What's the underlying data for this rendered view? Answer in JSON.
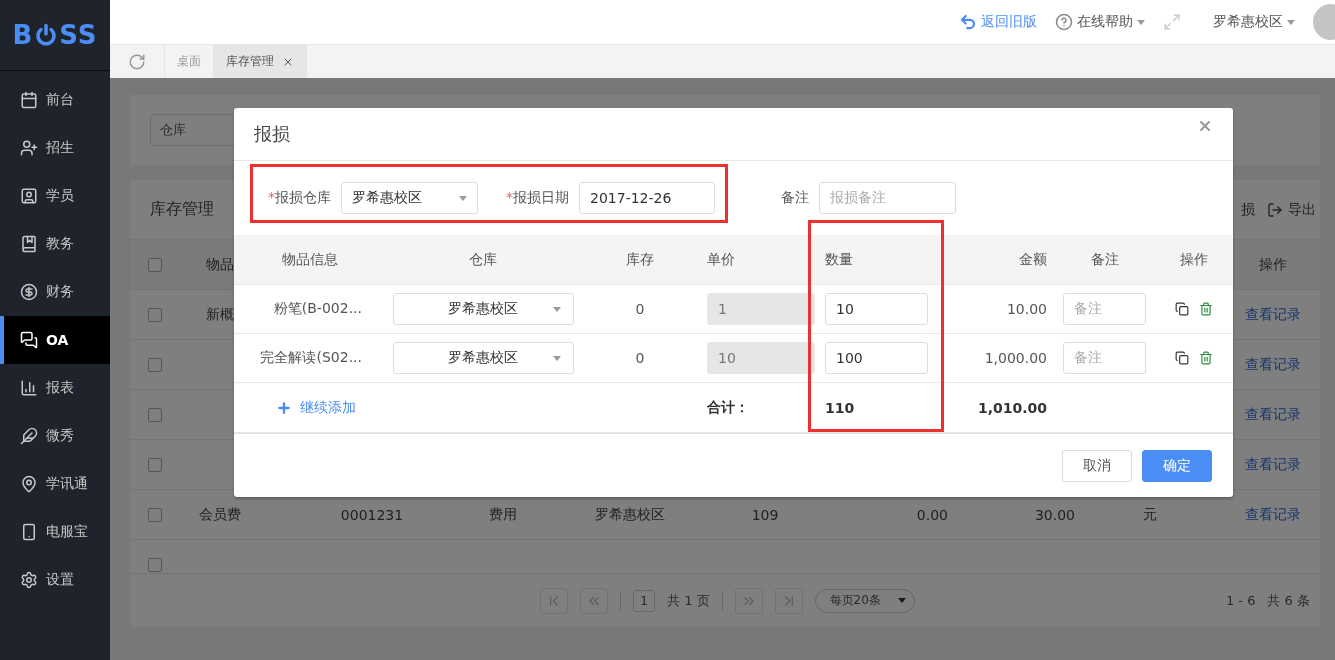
{
  "logo": {
    "before": "B",
    "after": "SS"
  },
  "sidebar": {
    "items": [
      {
        "label": "前台",
        "selected": false
      },
      {
        "label": "招生",
        "selected": false
      },
      {
        "label": "学员",
        "selected": false
      },
      {
        "label": "教务",
        "selected": false
      },
      {
        "label": "财务",
        "selected": false
      },
      {
        "label": "OA",
        "selected": true
      },
      {
        "label": "报表",
        "selected": false
      },
      {
        "label": "微秀",
        "selected": false
      },
      {
        "label": "学讯通",
        "selected": false
      },
      {
        "label": "电服宝",
        "selected": false
      },
      {
        "label": "设置",
        "selected": false
      }
    ]
  },
  "header": {
    "back_link": "返回旧版",
    "help": "在线帮助",
    "campus": "罗希惠校区"
  },
  "tabs": [
    {
      "label": "桌面",
      "selected": false,
      "closable": false
    },
    {
      "label": "库存管理",
      "selected": true,
      "closable": true
    }
  ],
  "filter": {
    "warehouse": "仓库"
  },
  "panel": {
    "title": "库存管理",
    "actions": [
      {
        "label": "损",
        "kind": "plain"
      },
      {
        "label": "导出",
        "kind": "export"
      }
    ]
  },
  "table": {
    "select_all_checked": false,
    "columns": {
      "first": "物品",
      "last": "操作"
    },
    "rows": [
      {
        "checked": false,
        "name": "新概",
        "link": "查看记录"
      },
      {
        "checked": false,
        "link": "查看记录"
      },
      {
        "checked": false,
        "link": "查看记录"
      },
      {
        "checked": false,
        "link": "查看记录"
      },
      {
        "checked": false,
        "name": "会员费",
        "code": "0001231",
        "type": "费用",
        "warehouse": "罗希惠校区",
        "stock": "109",
        "price": "0.00",
        "amount": "30.00",
        "unit": "元",
        "link": "查看记录"
      },
      {
        "checked": false
      }
    ]
  },
  "pagination": {
    "page": "1",
    "total_pages": "共 1 页",
    "page_size": "每页20条",
    "range": "1 - 6",
    "total": "共 6 条"
  },
  "dialog": {
    "title": "报损",
    "form": {
      "warehouse_label": "报损仓库",
      "warehouse": "罗希惠校区",
      "date_label": "报损日期",
      "date": "2017-12-26",
      "note_label": "备注",
      "note_placeholder": "报损备注",
      "required_mark": "*"
    },
    "columns": [
      "物品信息",
      "仓库",
      "库存",
      "单价",
      "数量",
      "金额",
      "备注",
      "操作"
    ],
    "rows": [
      {
        "name": "粉笔(B-002...",
        "warehouse": "罗希惠校区",
        "stock": "0",
        "price": "1",
        "quantity": "10",
        "amount": "10.00",
        "note_placeholder": "备注"
      },
      {
        "name": "完全解读(S02...",
        "warehouse": "罗希惠校区",
        "stock": "0",
        "price": "10",
        "quantity": "100",
        "amount": "1,000.00",
        "note_placeholder": "备注"
      }
    ],
    "add_link": "继续添加",
    "total_label": "合计：",
    "total_quantity": "110",
    "total_amount": "1,010.00",
    "buttons": {
      "cancel": "取消",
      "confirm": "确定"
    }
  }
}
